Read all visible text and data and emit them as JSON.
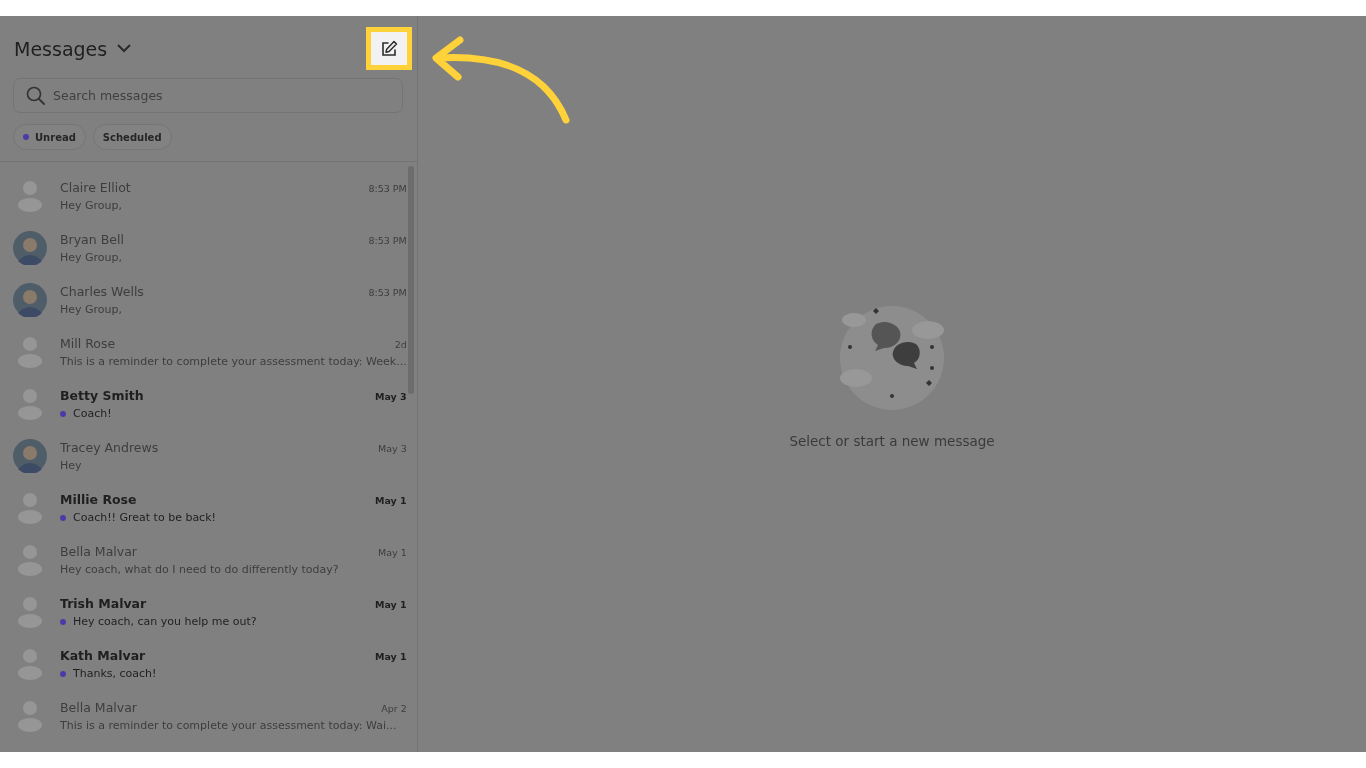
{
  "sidebar": {
    "title": "Messages",
    "search": {
      "placeholder": "Search messages"
    },
    "filters": [
      {
        "label": "Unread",
        "color": "#4b3aa8"
      },
      {
        "label": "Scheduled"
      }
    ],
    "conversations": [
      {
        "name": "Claire Elliot",
        "time": "8:53 PM",
        "preview": "Hey Group,",
        "unread": false,
        "kind": "placeholder"
      },
      {
        "name": "Bryan Bell",
        "time": "8:53 PM",
        "preview": "Hey Group,",
        "unread": false
      },
      {
        "name": "Charles Wells",
        "time": "8:53 PM",
        "preview": "Hey Group,",
        "unread": false
      },
      {
        "name": "Mill Rose",
        "time": "2d",
        "preview": "This is a reminder to complete your assessment today: Week...",
        "unread": false,
        "kind": "placeholder"
      },
      {
        "name": "Betty Smith",
        "time": "May 3",
        "preview": "Coach!",
        "unread": true,
        "kind": "placeholder"
      },
      {
        "name": "Tracey Andrews",
        "time": "May 3",
        "preview": "Hey",
        "unread": false
      },
      {
        "name": "Millie Rose",
        "time": "May 1",
        "preview": "Coach!! Great to be back!",
        "unread": true,
        "kind": "placeholder"
      },
      {
        "name": "Bella Malvar",
        "time": "May 1",
        "preview": "Hey coach, what do I need to do differently today?",
        "unread": false,
        "kind": "placeholder"
      },
      {
        "name": "Trish Malvar",
        "time": "May 1",
        "preview": "Hey coach, can you help me out?",
        "unread": true,
        "kind": "placeholder"
      },
      {
        "name": "Kath Malvar",
        "time": "May 1",
        "preview": "Thanks, coach!",
        "unread": true,
        "kind": "placeholder"
      },
      {
        "name": "Bella Malvar",
        "time": "Apr 2",
        "preview": "This is a reminder to complete your assessment today: Wai...",
        "unread": false,
        "kind": "placeholder"
      }
    ]
  },
  "empty_state": {
    "message": "Select or start a new message"
  }
}
